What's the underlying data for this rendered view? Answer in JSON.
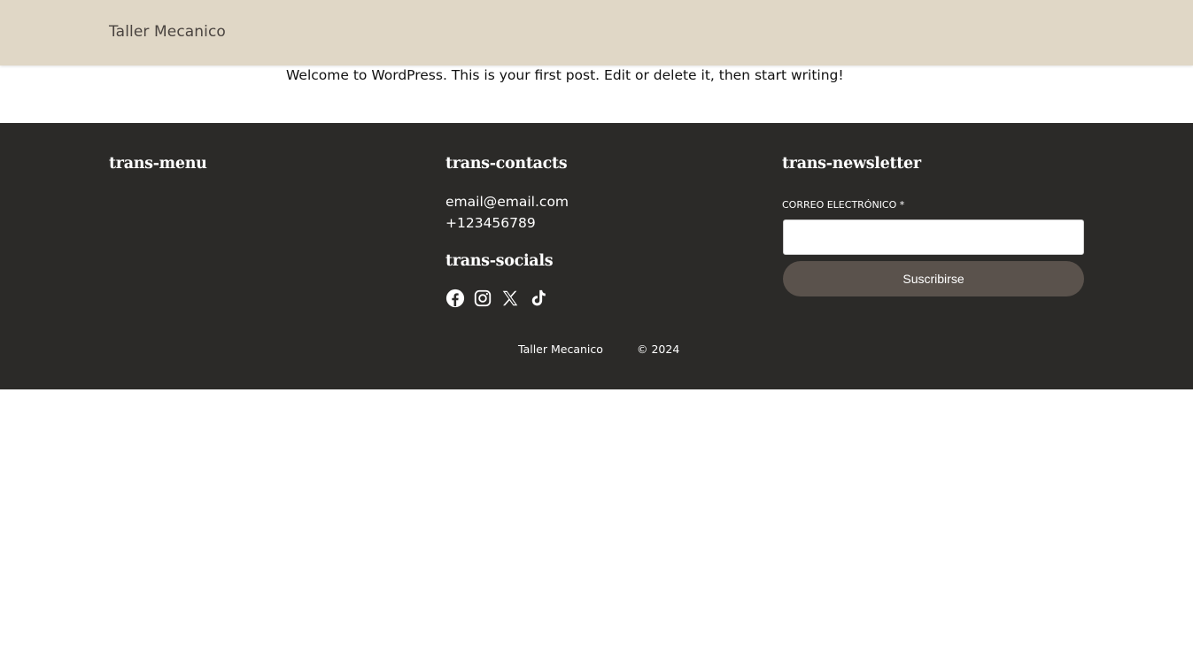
{
  "header": {
    "site_title": "Taller Mecanico"
  },
  "post": {
    "text": "Welcome to WordPress. This is your first post. Edit or delete it, then start writing!"
  },
  "footer": {
    "menu_title": "trans-menu",
    "contacts_title": "trans-contacts",
    "contacts": {
      "email": "email@email.com",
      "phone": "+123456789"
    },
    "socials_title": "trans-socials",
    "socials": [
      {
        "name": "facebook-icon"
      },
      {
        "name": "instagram-icon"
      },
      {
        "name": "x-icon"
      },
      {
        "name": "tiktok-icon"
      }
    ],
    "newsletter_title": "trans-newsletter",
    "newsletter": {
      "label": "CORREO ELECTRÓNICO *",
      "input_value": "",
      "button_label": "Suscribirse"
    },
    "copyright": {
      "name": "Taller Mecanico",
      "year": "© 2024"
    }
  },
  "colors": {
    "header_bg": "#e0d7c6",
    "footer_bg": "#2b2a28",
    "button_bg": "#5a524c"
  }
}
